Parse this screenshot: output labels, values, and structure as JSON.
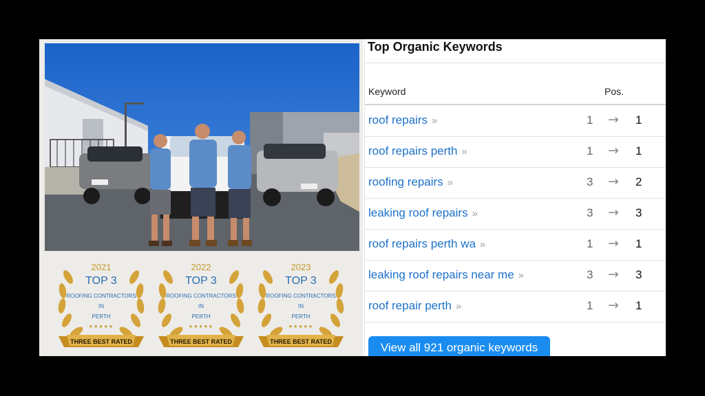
{
  "awards": [
    {
      "year": "2021",
      "top": "TOP 3",
      "line1": "ROOFING CONTRACTORS",
      "line2": "IN",
      "line3": "PERTH",
      "stars": "★★★★★",
      "ribbon": "THREE BEST RATED"
    },
    {
      "year": "2022",
      "top": "TOP 3",
      "line1": "ROOFING CONTRACTORS",
      "line2": "IN",
      "line3": "PERTH",
      "stars": "★★★★★",
      "ribbon": "THREE BEST RATED"
    },
    {
      "year": "2023",
      "top": "TOP 3",
      "line1": "ROOFING CONTRACTORS",
      "line2": "IN",
      "line3": "PERTH",
      "stars": "★★★★★",
      "ribbon": "THREE BEST RATED"
    }
  ],
  "keywords_panel": {
    "title": "Top Organic Keywords",
    "col_keyword": "Keyword",
    "col_pos": "Pos.",
    "rows": [
      {
        "keyword": "roof repairs",
        "prev": "1",
        "pos": "1"
      },
      {
        "keyword": "roof repairs perth",
        "prev": "1",
        "pos": "1"
      },
      {
        "keyword": "roofing repairs",
        "prev": "3",
        "pos": "2"
      },
      {
        "keyword": "leaking roof repairs",
        "prev": "3",
        "pos": "3"
      },
      {
        "keyword": "roof repairs perth wa",
        "prev": "1",
        "pos": "1"
      },
      {
        "keyword": "leaking roof repairs near me",
        "prev": "3",
        "pos": "3"
      },
      {
        "keyword": "roof repair perth",
        "prev": "1",
        "pos": "1"
      }
    ],
    "chevron": "»",
    "arrow": "→",
    "view_all": "View all 921 organic keywords"
  },
  "colors": {
    "link": "#1d71c9",
    "button": "#1a8cf0",
    "gold": "#c39a2a"
  }
}
